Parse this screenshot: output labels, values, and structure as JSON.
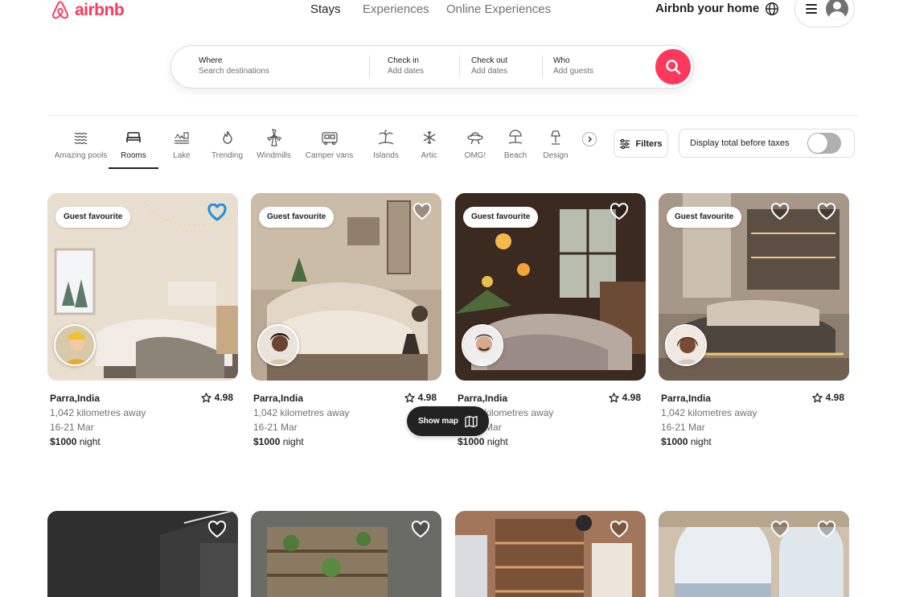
{
  "header": {
    "brand": "airbnb",
    "nav": [
      {
        "label": "Stays",
        "active": true
      },
      {
        "label": "Experiences",
        "active": false
      },
      {
        "label": "Online Experiences",
        "active": false
      }
    ],
    "host_link": "Airbnb your home",
    "icons": {
      "globe": "globe-icon",
      "menu": "hamburger-menu-icon",
      "profile": "user-avatar-icon"
    }
  },
  "search": {
    "where": {
      "label": "Where",
      "placeholder": "Search destinations"
    },
    "checkin": {
      "label": "Check in",
      "placeholder": "Add dates"
    },
    "checkout": {
      "label": "Check out",
      "placeholder": "Add dates"
    },
    "who": {
      "label": "Who",
      "placeholder": "Add guests"
    },
    "button_icon": "search-icon"
  },
  "categories": [
    {
      "label": "Amazing pools",
      "icon": "pool-waves-icon",
      "active": false
    },
    {
      "label": "Rooms",
      "icon": "bed-icon",
      "active": true
    },
    {
      "label": "Lake",
      "icon": "lake-icon",
      "active": false
    },
    {
      "label": "Trending",
      "icon": "flame-icon",
      "active": false
    },
    {
      "label": "Windmills",
      "icon": "windmill-icon",
      "active": false
    },
    {
      "label": "Camper vans",
      "icon": "camper-van-icon",
      "active": false
    },
    {
      "label": "Islands",
      "icon": "palm-island-icon",
      "active": false
    },
    {
      "label": "Artic",
      "icon": "snowflake-icon",
      "active": false
    },
    {
      "label": "OMG!",
      "icon": "ufo-icon",
      "active": false
    },
    {
      "label": "Beach",
      "icon": "beach-umbrella-icon",
      "active": false
    },
    {
      "label": "Design",
      "icon": "design-lamp-icon",
      "active": false
    }
  ],
  "filters": {
    "label": "Filters",
    "icon": "sliders-icon"
  },
  "tax_toggle": {
    "label": "Display total before taxes",
    "on": false
  },
  "listings": [
    {
      "badge": "Guest favourite",
      "title": "Parra,India",
      "rating": "4.98",
      "distance": "1,042 kilometres away",
      "dates": "16-21 Mar",
      "price": "$1000",
      "price_unit": " night",
      "favorited": true
    },
    {
      "badge": "Guest favourite",
      "title": "Parra,India",
      "rating": "4.98",
      "distance": "1,042 kilometres away",
      "dates": "16-21 Mar",
      "price": "$1000",
      "price_unit": " night",
      "favorited": false
    },
    {
      "badge": "Guest favourite",
      "title": "Parra,India",
      "rating": "4.98",
      "distance": "1,042 kilometres away",
      "dates": "16-21 Mar",
      "price": "$1000",
      "price_unit": " night",
      "favorited": false
    },
    {
      "badge": "Guest favourite",
      "title": "Parra,India",
      "rating": "4.98",
      "distance": "1,042 kilometres away",
      "dates": "16-21 Mar",
      "price": "$1000",
      "price_unit": " night",
      "favorited": false
    }
  ],
  "show_map": {
    "label": "Show map",
    "icon": "map-icon"
  },
  "colors": {
    "brand": "#FF385C",
    "text": "#222222",
    "muted": "#717171",
    "favorite_heart": "#1D8FE1"
  }
}
